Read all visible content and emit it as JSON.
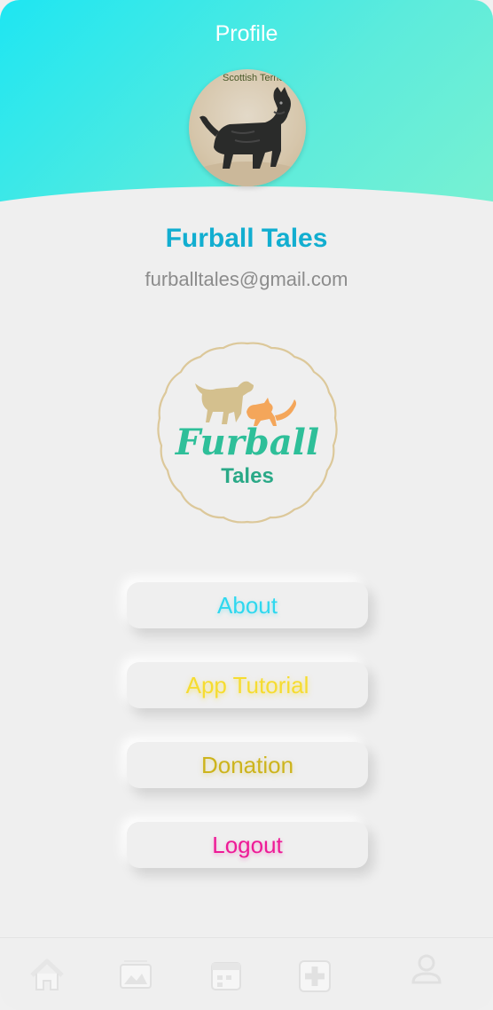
{
  "header": {
    "title": "Profile",
    "gradient_start": "#1ee6f2",
    "gradient_end": "#7ef2d0"
  },
  "profile": {
    "avatar_caption": "Scottish Terrier",
    "avatar_icon": "scottish-terrier-photo",
    "name": "Furball Tales",
    "email": "furballtales@gmail.com"
  },
  "logo": {
    "line1": "Furball",
    "line2": "Tales",
    "icon": "dog-and-cat-logo"
  },
  "menu": {
    "about": "About",
    "tutorial": "App Tutorial",
    "donation": "Donation",
    "logout": "Logout"
  },
  "bottom_nav": {
    "items": [
      "home-icon",
      "gallery-icon",
      "calendar-icon",
      "medical-plus-icon",
      "profile-icon"
    ]
  },
  "colors": {
    "accent": "#12aed0",
    "about": "#2fd8ef",
    "tutorial": "#f6dc30",
    "donation": "#cdb41c",
    "logout": "#ee1a97",
    "logo_text": "#2ebf99",
    "logo_dog": "#d4c08e",
    "logo_cat": "#f4a65a"
  }
}
